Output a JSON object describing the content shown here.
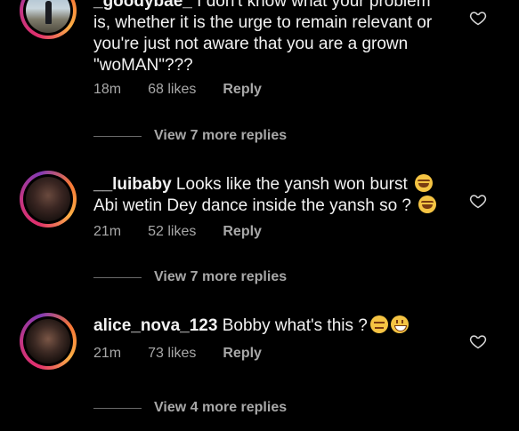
{
  "comments": [
    {
      "username": "_goodybae_",
      "text": " I don't know what your problem is, whether it is the urge to remain relevant or you're just not aware that you are a grown \"woMAN\"???",
      "time": "18m",
      "likes": "68 likes",
      "reply_label": "Reply",
      "view_more": "View 7 more replies"
    },
    {
      "username": "__luibaby",
      "text": " Looks like the yansh won burst ",
      "text2": "Abi wetin Dey dance inside the yansh so ? ",
      "time": "21m",
      "likes": "52 likes",
      "reply_label": "Reply",
      "view_more": "View 7 more replies"
    },
    {
      "username": "alice_nova_123",
      "text": " Bobby what's this ?",
      "time": "21m",
      "likes": "73 likes",
      "reply_label": "Reply",
      "view_more": "View 4 more replies"
    }
  ],
  "icons": {
    "like": "heart-icon"
  },
  "colors": {
    "background": "#000000",
    "text": "#f2f2f2",
    "muted": "#a8a8a8"
  }
}
